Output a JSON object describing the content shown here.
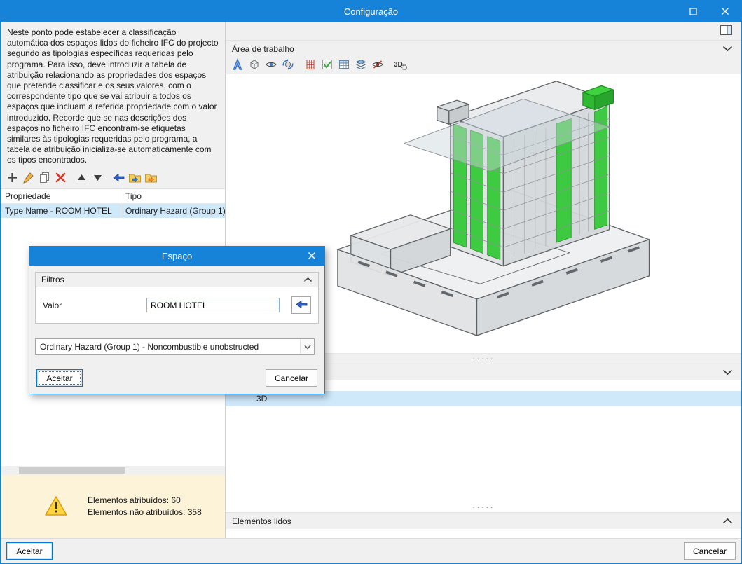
{
  "window": {
    "title": "Configuração"
  },
  "colors": {
    "titlebar_blue": "#1683d9",
    "selection_blue": "#cfe9fb",
    "warning_bg": "#fdf3d8",
    "model_green": "#35c838"
  },
  "left_panel": {
    "intro_text": "Neste ponto pode estabelecer a classificação automática dos espaços lidos do ficheiro IFC do projecto segundo as tipologias específicas requeridas pelo programa. Para isso, deve introduzir a tabela de atribuição relacionando as propriedades dos espaços que pretende classificar e os seus valores, com o correspondente tipo que se vai atribuir a todos os espaços que incluam a referida propriedade com o valor introduzido. Recorde que se nas descrições dos espaços no ficheiro IFC encontram-se etiquetas similares às tipologias requeridas pelo programa, a tabela de atribuição inicializa-se automaticamente com os tipos encontrados.",
    "toolbar_icons": [
      "add",
      "edit",
      "copy",
      "delete",
      "move-up",
      "move-down",
      "assign-arrow",
      "import-folder",
      "export-folder"
    ],
    "table": {
      "headers": [
        "Propriedade",
        "Tipo"
      ],
      "rows": [
        {
          "propriedade": "Type Name - ROOM HOTEL",
          "tipo": "Ordinary Hazard (Group 1)"
        }
      ]
    },
    "warning": {
      "line1": "Elementos atribuídos: 60",
      "line2": "Elementos não atribuídos: 358"
    }
  },
  "modal": {
    "title": "Espaço",
    "filters_label": "Filtros",
    "value_label": "Valor",
    "value": "ROOM HOTEL",
    "type_value": "Ordinary Hazard (Group 1) - Noncombustible unobstructed",
    "accept_label": "Aceitar",
    "cancel_label": "Cancelar"
  },
  "right_panel": {
    "work_area_label": "Área de trabalho",
    "toolbar_icons": [
      "set-square",
      "cube",
      "eye",
      "orbit",
      "building-grid",
      "check-grid",
      "table",
      "layers",
      "visibility",
      "3d-settings"
    ],
    "layout_icon": "window-layout",
    "view_label": "3D",
    "elements_read_label": "Elementos lidos"
  },
  "footer": {
    "accept_label": "Aceitar",
    "cancel_label": "Cancelar"
  }
}
